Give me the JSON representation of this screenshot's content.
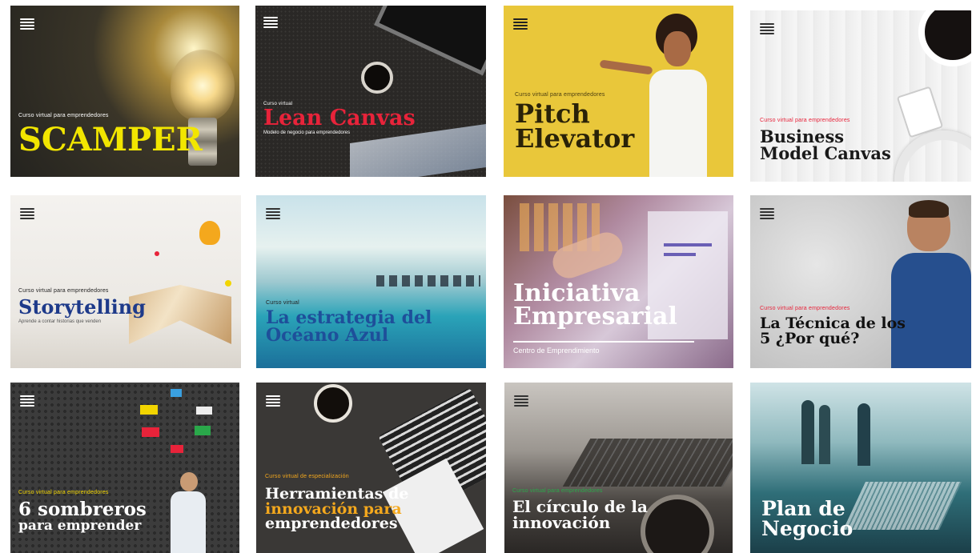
{
  "cards": [
    {
      "subtitle": "Curso virtual para emprendedores",
      "title": "SCAMPER"
    },
    {
      "subtitle": "Curso virtual",
      "title": "Lean Canvas",
      "tagline": "Modelo de negocio para emprendedores"
    },
    {
      "subtitle": "Curso virtual para emprendedores",
      "title_lines": [
        "Pitch",
        "Elevator"
      ]
    },
    {
      "subtitle": "Curso virtual para emprendedores",
      "title_lines": [
        "Business",
        "Model Canvas"
      ]
    },
    {
      "subtitle": "Curso virtual para emprendedores",
      "title": "Storytelling",
      "tagline": "Aprende a contar historias que venden"
    },
    {
      "subtitle": "Curso virtual",
      "title_lines": [
        "La estrategia del",
        "Océano Azul"
      ]
    },
    {
      "title_lines": [
        "Iniciativa",
        "Empresarial"
      ],
      "tagline": "Centro de Emprendimiento"
    },
    {
      "subtitle": "Curso virtual para emprendedores",
      "title_lines": [
        "La Técnica de los",
        "5 ¿Por qué?"
      ]
    },
    {
      "subtitle": "Curso virtual para emprendedores",
      "title_lines": [
        "6 sombreros",
        "para emprender"
      ]
    },
    {
      "subtitle": "Curso virtual de especialización",
      "title_lines": [
        "Herramientas de",
        "innovación para",
        "emprendedores"
      ]
    },
    {
      "subtitle": "Curso virtual para emprendedores",
      "title_lines": [
        "El círculo de la",
        "innovación"
      ]
    },
    {
      "title_lines": [
        "Plan de",
        "Negocio"
      ]
    }
  ],
  "logo_icon": "institution-logo-icon",
  "colors": {
    "scamper_yellow": "#f2e600",
    "lean_red": "#e8233a",
    "pitch_yellow": "#e9c73a",
    "storytelling_blue": "#1e3a8a",
    "herramientas_orange": "#f4a81d",
    "accent_red": "#e8233a"
  }
}
